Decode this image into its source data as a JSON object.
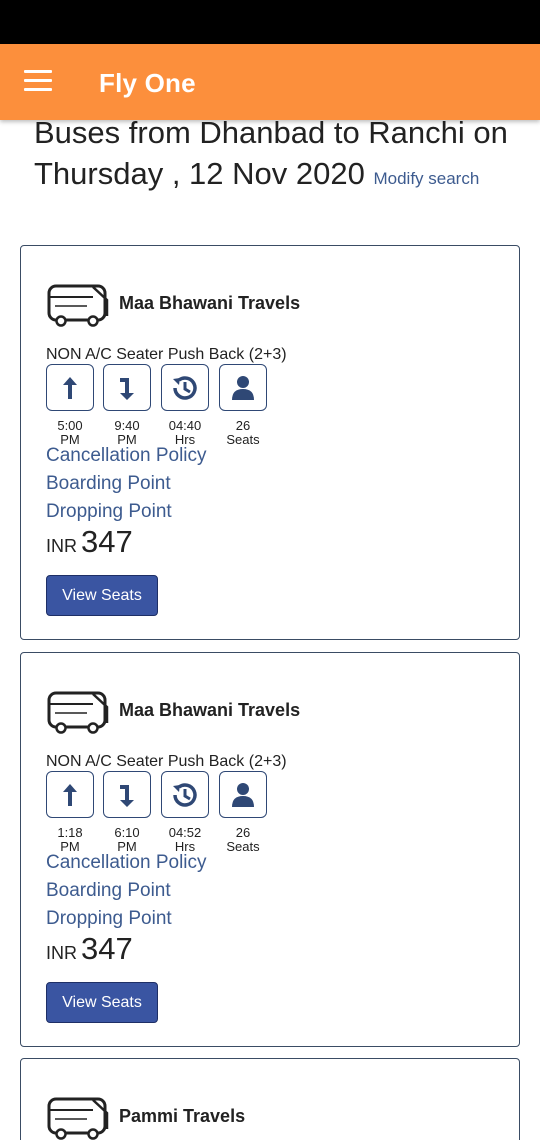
{
  "app": {
    "title": "Fly One"
  },
  "search": {
    "heading": "Buses from Dhanbad to Ranchi on Thursday , 12 Nov 2020",
    "modify_label": "Modify search"
  },
  "buses": [
    {
      "operator": "Maa Bhawani Travels",
      "type": "NON A/C Seater Push Back (2+3)",
      "departure_time": "5:00",
      "departure_ampm": "PM",
      "arrival_time": "9:40",
      "arrival_ampm": "PM",
      "duration": "04:40",
      "duration_unit": "Hrs",
      "seats": "26",
      "seats_label": "Seats",
      "cancellation_label": "Cancellation Policy",
      "boarding_label": "Boarding Point",
      "dropping_label": "Dropping Point",
      "currency": "INR",
      "price": "347",
      "view_seats_label": "View Seats"
    },
    {
      "operator": "Maa Bhawani Travels",
      "type": "NON A/C Seater Push Back (2+3)",
      "departure_time": "1:18",
      "departure_ampm": "PM",
      "arrival_time": "6:10",
      "arrival_ampm": "PM",
      "duration": "04:52",
      "duration_unit": "Hrs",
      "seats": "26",
      "seats_label": "Seats",
      "cancellation_label": "Cancellation Policy",
      "boarding_label": "Boarding Point",
      "dropping_label": "Dropping Point",
      "currency": "INR",
      "price": "347",
      "view_seats_label": "View Seats"
    },
    {
      "operator": "Pammi Travels"
    }
  ],
  "colors": {
    "appbar": "#fc8f3c",
    "link": "#3d5b8f",
    "button": "#3a55a2",
    "icon": "#2f4875"
  },
  "icons": [
    "menu-icon",
    "bus-icon",
    "departure-arrow-icon",
    "arrival-arrow-icon",
    "duration-clock-icon",
    "seat-person-icon"
  ]
}
